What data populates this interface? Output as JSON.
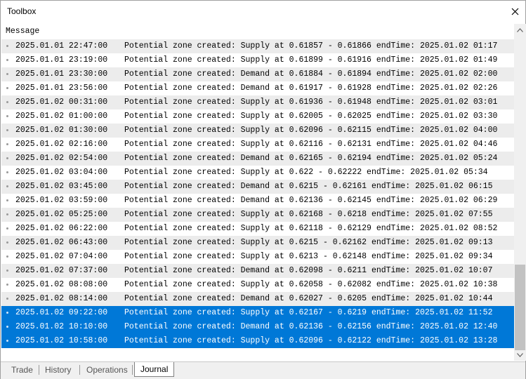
{
  "window": {
    "title": "Toolbox"
  },
  "header": {
    "message_label": "Message"
  },
  "log": [
    {
      "time": "2025.01.01 22:47:00",
      "message": "Potential zone created: Supply at 0.61857 - 0.61866 endTime: 2025.01.02 01:17",
      "selected": false
    },
    {
      "time": "2025.01.01 23:19:00",
      "message": "Potential zone created: Supply at 0.61899 - 0.61916 endTime: 2025.01.02 01:49",
      "selected": false
    },
    {
      "time": "2025.01.01 23:30:00",
      "message": "Potential zone created: Demand at 0.61884 - 0.61894 endTime: 2025.01.02 02:00",
      "selected": false
    },
    {
      "time": "2025.01.01 23:56:00",
      "message": "Potential zone created: Demand at 0.61917 - 0.61928 endTime: 2025.01.02 02:26",
      "selected": false
    },
    {
      "time": "2025.01.02 00:31:00",
      "message": "Potential zone created: Supply at 0.61936 - 0.61948 endTime: 2025.01.02 03:01",
      "selected": false
    },
    {
      "time": "2025.01.02 01:00:00",
      "message": "Potential zone created: Supply at 0.62005 - 0.62025 endTime: 2025.01.02 03:30",
      "selected": false
    },
    {
      "time": "2025.01.02 01:30:00",
      "message": "Potential zone created: Supply at 0.62096 - 0.62115 endTime: 2025.01.02 04:00",
      "selected": false
    },
    {
      "time": "2025.01.02 02:16:00",
      "message": "Potential zone created: Supply at 0.62116 - 0.62131 endTime: 2025.01.02 04:46",
      "selected": false
    },
    {
      "time": "2025.01.02 02:54:00",
      "message": "Potential zone created: Demand at 0.62165 - 0.62194 endTime: 2025.01.02 05:24",
      "selected": false
    },
    {
      "time": "2025.01.02 03:04:00",
      "message": "Potential zone created: Supply at 0.622 - 0.62222 endTime: 2025.01.02 05:34",
      "selected": false
    },
    {
      "time": "2025.01.02 03:45:00",
      "message": "Potential zone created: Demand at 0.6215 - 0.62161 endTime: 2025.01.02 06:15",
      "selected": false
    },
    {
      "time": "2025.01.02 03:59:00",
      "message": "Potential zone created: Demand at 0.62136 - 0.62145 endTime: 2025.01.02 06:29",
      "selected": false
    },
    {
      "time": "2025.01.02 05:25:00",
      "message": "Potential zone created: Supply at 0.62168 - 0.6218 endTime: 2025.01.02 07:55",
      "selected": false
    },
    {
      "time": "2025.01.02 06:22:00",
      "message": "Potential zone created: Supply at 0.62118 - 0.62129 endTime: 2025.01.02 08:52",
      "selected": false
    },
    {
      "time": "2025.01.02 06:43:00",
      "message": "Potential zone created: Supply at 0.6215 - 0.62162 endTime: 2025.01.02 09:13",
      "selected": false
    },
    {
      "time": "2025.01.02 07:04:00",
      "message": "Potential zone created: Supply at 0.6213 - 0.62148 endTime: 2025.01.02 09:34",
      "selected": false
    },
    {
      "time": "2025.01.02 07:37:00",
      "message": "Potential zone created: Demand at 0.62098 - 0.6211 endTime: 2025.01.02 10:07",
      "selected": false
    },
    {
      "time": "2025.01.02 08:08:00",
      "message": "Potential zone created: Supply at 0.62058 - 0.62082 endTime: 2025.01.02 10:38",
      "selected": false
    },
    {
      "time": "2025.01.02 08:14:00",
      "message": "Potential zone created: Demand at 0.62027 - 0.6205 endTime: 2025.01.02 10:44",
      "selected": false
    },
    {
      "time": "2025.01.02 09:22:00",
      "message": "Potential zone created: Supply at 0.62167 - 0.6219 endTime: 2025.01.02 11:52",
      "selected": true
    },
    {
      "time": "2025.01.02 10:10:00",
      "message": "Potential zone created: Demand at 0.62136 - 0.62156 endTime: 2025.01.02 12:40",
      "selected": true
    },
    {
      "time": "2025.01.02 10:58:00",
      "message": "Potential zone created: Supply at 0.62096 - 0.62122 endTime: 2025.01.02 13:28",
      "selected": true
    }
  ],
  "tabs": [
    {
      "label": "Trade",
      "active": false
    },
    {
      "label": "History",
      "active": false
    },
    {
      "label": "Operations",
      "active": false
    },
    {
      "label": "Journal",
      "active": true
    }
  ],
  "icons": {
    "close": "close-icon",
    "scroll_up": "chevron-up-icon",
    "scroll_down": "chevron-down-icon"
  },
  "colors": {
    "selection": "#0078d7",
    "row_alt": "#ececec"
  }
}
